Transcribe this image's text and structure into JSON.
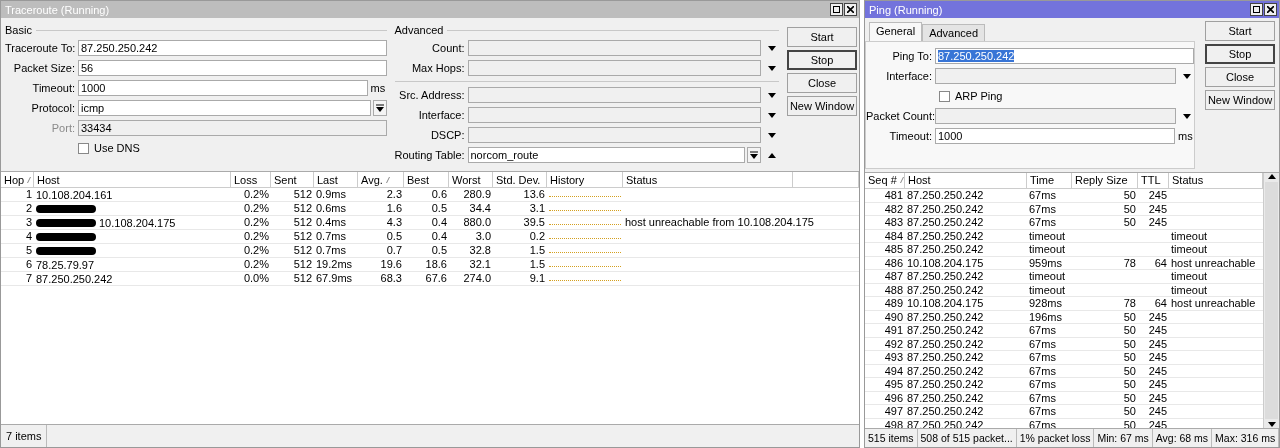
{
  "traceroute": {
    "window": {
      "title": "Traceroute (Running)",
      "active": false
    },
    "basic": {
      "legend": "Basic",
      "fields": [
        {
          "label": "Traceroute To:",
          "value": "87.250.250.242",
          "kind": "text"
        },
        {
          "label": "Packet Size:",
          "value": "56",
          "kind": "text"
        },
        {
          "label": "Timeout:",
          "value": "1000",
          "kind": "text",
          "unit": "ms"
        },
        {
          "label": "Protocol:",
          "value": "icmp",
          "kind": "select"
        },
        {
          "label": "Port:",
          "value": "33434",
          "kind": "disabled"
        }
      ],
      "checkbox": {
        "label": "Use DNS",
        "checked": false
      }
    },
    "advanced": {
      "legend": "Advanced",
      "groups": [
        [
          {
            "label": "Count:",
            "kind": "dropdown"
          },
          {
            "label": "Max Hops:",
            "kind": "dropdown"
          }
        ],
        [
          {
            "label": "Src. Address:",
            "kind": "dropdown"
          },
          {
            "label": "Interface:",
            "kind": "dropdown"
          },
          {
            "label": "DSCP:",
            "kind": "dropdown"
          },
          {
            "label": "Routing Table:",
            "value": "norcom_route",
            "kind": "select",
            "collapse": true
          }
        ]
      ]
    },
    "buttons": [
      {
        "label": "Start",
        "focused": false
      },
      {
        "label": "Stop",
        "focused": true
      },
      {
        "label": "Close",
        "focused": false
      },
      {
        "label": "New Window",
        "focused": false
      }
    ],
    "table": {
      "columns": [
        {
          "label": "Hop",
          "sorted": true
        },
        {
          "label": "Host",
          "sorted": false
        },
        {
          "label": "Loss",
          "sorted": false
        },
        {
          "label": "Sent",
          "sorted": false
        },
        {
          "label": "Last",
          "sorted": false
        },
        {
          "label": "Avg.",
          "sorted": true
        },
        {
          "label": "Best",
          "sorted": false
        },
        {
          "label": "Worst",
          "sorted": false
        },
        {
          "label": "Std. Dev.",
          "sorted": false
        },
        {
          "label": "History",
          "sorted": false
        },
        {
          "label": "Status",
          "sorted": false
        }
      ],
      "rows": [
        {
          "hop": "1",
          "host": "10.108.204.161",
          "redacted": false,
          "loss": "0.2%",
          "sent": "512",
          "last": "0.9ms",
          "avg": "2.3",
          "best": "0.6",
          "worst": "280.9",
          "std_dev": "13.6"
        },
        {
          "hop": "2",
          "redacted": true,
          "loss": "0.2%",
          "sent": "512",
          "last": "0.6ms",
          "avg": "1.6",
          "best": "0.5",
          "worst": "34.4",
          "std_dev": "3.1"
        },
        {
          "hop": "3",
          "host": "10.108.204.175",
          "redacted": true,
          "loss": "0.2%",
          "sent": "512",
          "last": "0.4ms",
          "avg": "4.3",
          "best": "0.4",
          "worst": "880.0",
          "std_dev": "39.5",
          "status": "host unreachable from 10.108.204.175"
        },
        {
          "hop": "4",
          "redacted": true,
          "loss": "0.2%",
          "sent": "512",
          "last": "0.7ms",
          "avg": "0.5",
          "best": "0.4",
          "worst": "3.0",
          "std_dev": "0.2"
        },
        {
          "hop": "5",
          "redacted": true,
          "loss": "0.2%",
          "sent": "512",
          "last": "0.7ms",
          "avg": "0.7",
          "best": "0.5",
          "worst": "32.8",
          "std_dev": "1.5"
        },
        {
          "hop": "6",
          "host": "78.25.79.97",
          "redacted": false,
          "loss": "0.2%",
          "sent": "512",
          "last": "19.2ms",
          "avg": "19.6",
          "best": "18.6",
          "worst": "32.1",
          "std_dev": "1.5"
        },
        {
          "hop": "7",
          "host": "87.250.250.242",
          "redacted": false,
          "loss": "0.0%",
          "sent": "512",
          "last": "67.9ms",
          "avg": "68.3",
          "best": "67.6",
          "worst": "274.0",
          "std_dev": "9.1"
        }
      ]
    },
    "status_bar": [
      "7 items"
    ]
  },
  "ping": {
    "window": {
      "title": "Ping (Running)",
      "active": true
    },
    "tabs": [
      {
        "label": "General",
        "selected": true
      },
      {
        "label": "Advanced",
        "selected": false
      }
    ],
    "fields": [
      {
        "label": "Ping To:",
        "value": "87.250.250.242",
        "kind": "text",
        "highlighted": true
      },
      {
        "label": "Interface:",
        "kind": "dropdown"
      },
      {
        "label": "ARP Ping",
        "kind": "checkbox",
        "checked": false
      },
      {
        "label": "Packet Count:",
        "kind": "dropdown"
      },
      {
        "label": "Timeout:",
        "value": "1000",
        "kind": "text",
        "unit": "ms",
        "highlighted": false
      }
    ],
    "buttons": [
      {
        "label": "Start",
        "focused": false
      },
      {
        "label": "Stop",
        "focused": true
      },
      {
        "label": "Close",
        "focused": false
      },
      {
        "label": "New Window",
        "focused": false
      }
    ],
    "table": {
      "columns": [
        {
          "label": "Seq #",
          "sorted": true
        },
        {
          "label": "Host",
          "sorted": false
        },
        {
          "label": "Time",
          "sorted": false
        },
        {
          "label": "Reply Size",
          "sorted": false
        },
        {
          "label": "TTL",
          "sorted": false
        },
        {
          "label": "Status",
          "sorted": false
        }
      ],
      "rows": [
        [
          "481",
          "87.250.250.242",
          "67ms",
          "50",
          "245",
          ""
        ],
        [
          "482",
          "87.250.250.242",
          "67ms",
          "50",
          "245",
          ""
        ],
        [
          "483",
          "87.250.250.242",
          "67ms",
          "50",
          "245",
          ""
        ],
        [
          "484",
          "87.250.250.242",
          "timeout",
          "",
          "",
          "timeout"
        ],
        [
          "485",
          "87.250.250.242",
          "timeout",
          "",
          "",
          "timeout"
        ],
        [
          "486",
          "10.108.204.175",
          "959ms",
          "78",
          "64",
          "host unreachable"
        ],
        [
          "487",
          "87.250.250.242",
          "timeout",
          "",
          "",
          "timeout"
        ],
        [
          "488",
          "87.250.250.242",
          "timeout",
          "",
          "",
          "timeout"
        ],
        [
          "489",
          "10.108.204.175",
          "928ms",
          "78",
          "64",
          "host unreachable"
        ],
        [
          "490",
          "87.250.250.242",
          "196ms",
          "50",
          "245",
          ""
        ],
        [
          "491",
          "87.250.250.242",
          "67ms",
          "50",
          "245",
          ""
        ],
        [
          "492",
          "87.250.250.242",
          "67ms",
          "50",
          "245",
          ""
        ],
        [
          "493",
          "87.250.250.242",
          "67ms",
          "50",
          "245",
          ""
        ],
        [
          "494",
          "87.250.250.242",
          "67ms",
          "50",
          "245",
          ""
        ],
        [
          "495",
          "87.250.250.242",
          "67ms",
          "50",
          "245",
          ""
        ],
        [
          "496",
          "87.250.250.242",
          "67ms",
          "50",
          "245",
          ""
        ],
        [
          "497",
          "87.250.250.242",
          "67ms",
          "50",
          "245",
          ""
        ],
        [
          "498",
          "87.250.250.242",
          "67ms",
          "50",
          "245",
          ""
        ]
      ]
    },
    "status_bar": [
      "515 items",
      "508 of 515 packet...",
      "1% packet loss",
      "Min: 67 ms",
      "Avg: 68 ms",
      "Max: 316 ms"
    ]
  }
}
